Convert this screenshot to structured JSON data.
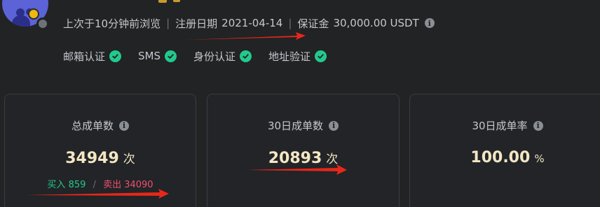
{
  "profile": {
    "last_seen": "上次于10分钟前浏览",
    "register_label": "注册日期",
    "register_date": "2021-04-14",
    "deposit_label": "保证金",
    "deposit_value": "30,000.00 USDT"
  },
  "verifications": [
    {
      "label": "邮箱认证"
    },
    {
      "label": "SMS"
    },
    {
      "label": "身份认证"
    },
    {
      "label": "地址验证"
    }
  ],
  "stats": {
    "total_orders": {
      "label": "总成单数",
      "value": "34949",
      "unit": "次",
      "buy_label": "买入",
      "buy_value": "859",
      "sell_label": "卖出",
      "sell_value": "34090"
    },
    "orders_30d": {
      "label": "30日成单数",
      "value": "20893",
      "unit": "次"
    },
    "rate_30d": {
      "label": "30日成单率",
      "value": "100.00",
      "unit": "%"
    }
  },
  "colors": {
    "background": "#212325",
    "success": "#22c98d",
    "sell": "#f0506e",
    "value": "#f3e6c4",
    "annotation_arrow": "#e8271a"
  }
}
